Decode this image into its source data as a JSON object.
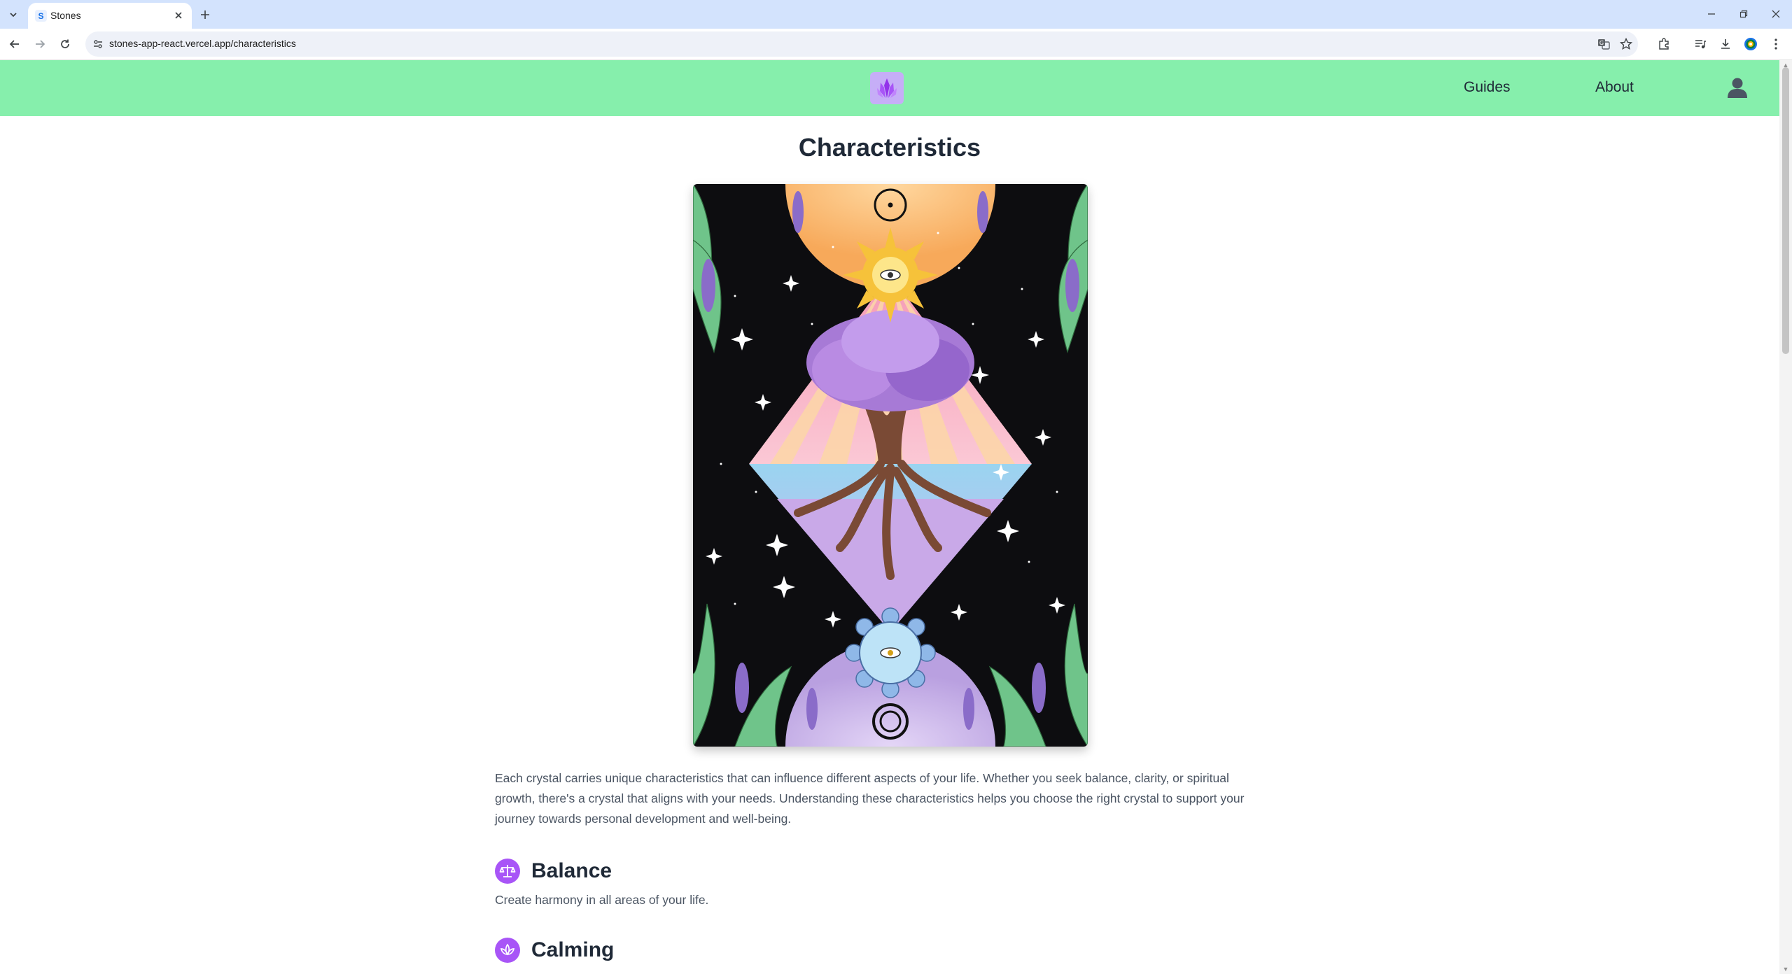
{
  "browser": {
    "tab_title": "Stones",
    "url": "stones-app-react.vercel.app/characteristics"
  },
  "header": {
    "nav": [
      {
        "label": "Guides"
      },
      {
        "label": "About"
      }
    ]
  },
  "page": {
    "title": "Characteristics",
    "intro": "Each crystal carries unique characteristics that can influence different aspects of your life. Whether you seek balance, clarity, or spiritual growth, there's a crystal that aligns with your needs. Understanding these characteristics helps you choose the right crystal to support your journey towards personal development and well-being.",
    "characteristics": [
      {
        "name": "Balance",
        "description": "Create harmony in all areas of your life.",
        "icon": "scales-icon"
      },
      {
        "name": "Calming",
        "description": "",
        "icon": "lotus-icon"
      }
    ]
  },
  "colors": {
    "header_bg": "#86efac",
    "accent": "#a855f7",
    "logo_bg": "#c6aef7",
    "chrome_tabbar": "#d3e3fd"
  }
}
